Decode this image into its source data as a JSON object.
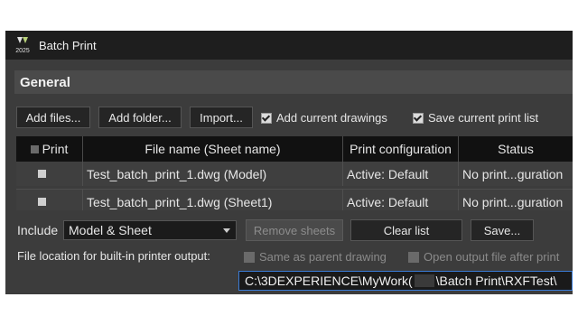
{
  "window": {
    "title": "Batch Print",
    "app_year": "2025"
  },
  "section": {
    "title": "General"
  },
  "toolbar": {
    "add_files": "Add files...",
    "add_folder": "Add folder...",
    "import": "Import...",
    "add_current_drawings": "Add current drawings",
    "save_current_print_list": "Save current print list"
  },
  "table": {
    "headers": {
      "print": "Print",
      "file_name": "File name (Sheet name)",
      "config": "Print configuration",
      "status": "Status"
    },
    "rows": [
      {
        "file": "Test_batch_print_1.dwg (Model)",
        "config": "Active: Default",
        "status": "No print...guration"
      },
      {
        "file": "Test_batch_print_1.dwg (Sheet1)",
        "config": "Active: Default",
        "status": "No print...guration"
      }
    ]
  },
  "include": {
    "label": "Include",
    "value": "Model & Sheet",
    "remove_sheets": "Remove sheets",
    "clear_list": "Clear list",
    "save": "Save..."
  },
  "output": {
    "label": "File location for built-in printer output:",
    "same_as_parent": "Same as parent drawing",
    "open_output": "Open output file after print",
    "path_start": "C:\\3DEXPERIENCE\\MyWork(",
    "path_end": "\\Batch Print\\RXFTest\\"
  }
}
